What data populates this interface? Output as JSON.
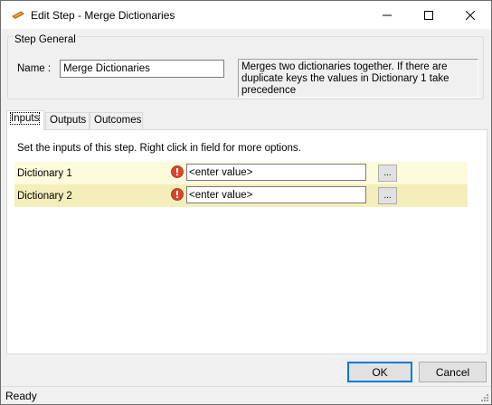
{
  "window": {
    "title": "Edit Step - Merge Dictionaries",
    "icon": "step-edit-icon"
  },
  "step_general": {
    "legend": "Step General",
    "name_label": "Name :",
    "name_value": "Merge Dictionaries",
    "description": "Merges two dictionaries together. If there are duplicate keys the values in Dictionary 1 take precedence"
  },
  "tabs": [
    {
      "label": "Inputs",
      "active": true
    },
    {
      "label": "Outputs",
      "active": false
    },
    {
      "label": "Outcomes",
      "active": false
    }
  ],
  "inputs_panel": {
    "hint": "Set the inputs of this step.  Right click in field for more options.",
    "rows": [
      {
        "label": "Dictionary 1",
        "value": "<enter value>",
        "button": "...",
        "status_icon": "error-icon"
      },
      {
        "label": "Dictionary 2",
        "value": "<enter value>",
        "button": "...",
        "status_icon": "error-icon"
      }
    ],
    "row_colors": [
      "#fdfbdc",
      "#f4eeba"
    ]
  },
  "buttons": {
    "ok": "OK",
    "cancel": "Cancel"
  },
  "status": "Ready",
  "colors": {
    "accent": "#0078d7",
    "error": "#d9462b"
  }
}
